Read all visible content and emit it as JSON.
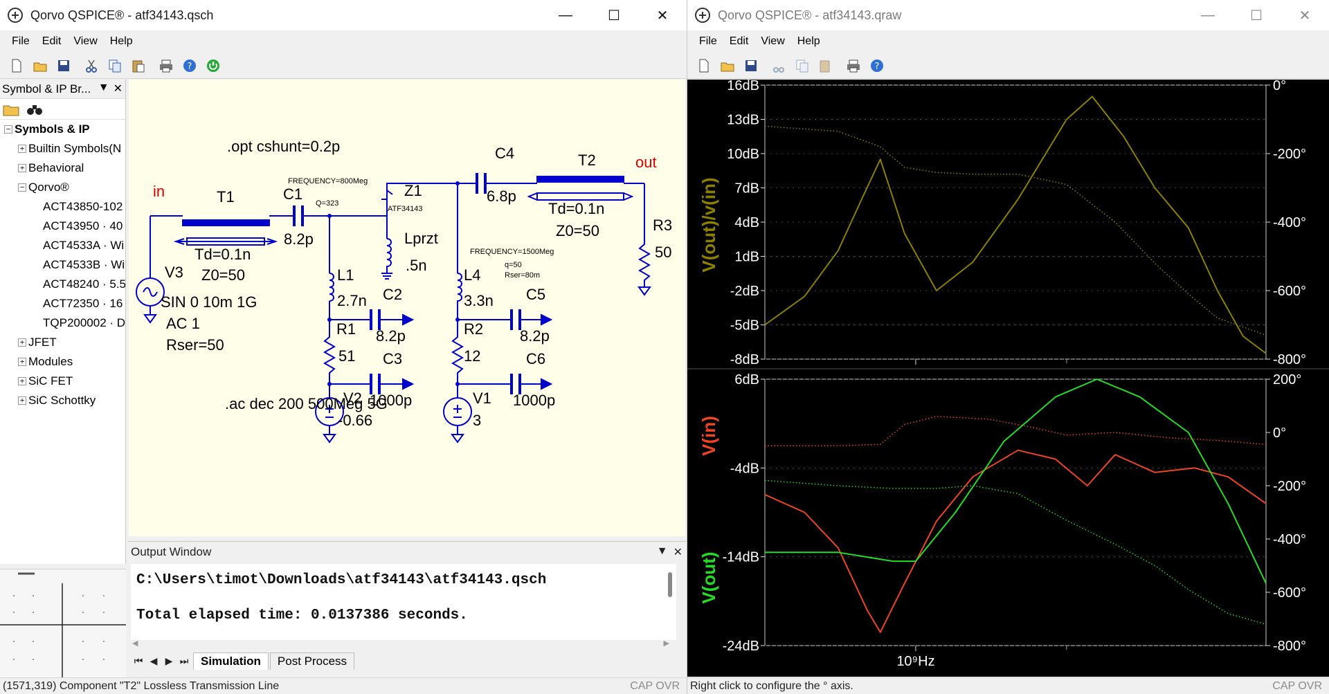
{
  "left_window": {
    "title": "Qorvo QSPICE® - atf34143.qsch",
    "menu": [
      "File",
      "Edit",
      "View",
      "Help"
    ],
    "symbol_browser": {
      "title": "Symbol & IP Br...",
      "tree": [
        {
          "label": "Symbols & IP",
          "level": 0,
          "exp": "⊟",
          "bold": true
        },
        {
          "label": "Builtin Symbols(N",
          "level": 1,
          "exp": "⊞"
        },
        {
          "label": "Behavioral",
          "level": 1,
          "exp": "⊞"
        },
        {
          "label": "Qorvo®",
          "level": 1,
          "exp": "⊟"
        },
        {
          "label": "ACT43850-102",
          "level": 2
        },
        {
          "label": "ACT43950 · 40",
          "level": 2
        },
        {
          "label": "ACT4533A · Wi",
          "level": 2
        },
        {
          "label": "ACT4533B · Wi",
          "level": 2
        },
        {
          "label": "ACT48240 · 5.5",
          "level": 2
        },
        {
          "label": "ACT72350 · 16",
          "level": 2
        },
        {
          "label": "TQP200002 · D",
          "level": 2
        },
        {
          "label": "JFET",
          "level": 1,
          "exp": "⊞"
        },
        {
          "label": "Modules",
          "level": 1,
          "exp": "⊞"
        },
        {
          "label": "SiC FET",
          "level": 1,
          "exp": "⊞"
        },
        {
          "label": "SiC Schottky",
          "level": 1,
          "exp": "⊞"
        }
      ]
    },
    "schematic": {
      "directive_opt": ".opt cshunt=0.2p",
      "directive_ac": ".ac dec 200 500Meg 5G",
      "in_label": "in",
      "out_label": "out",
      "T1": {
        "name": "T1",
        "td": "Td=0.1n",
        "z0": "Z0=50"
      },
      "T2": {
        "name": "T2",
        "td": "Td=0.1n",
        "z0": "Z0=50"
      },
      "C1": {
        "name": "C1",
        "value": "8.2p",
        "freq": "FREQUENCY=800Meg",
        "q": "Q=323"
      },
      "C4": {
        "name": "C4",
        "value": "6.8p"
      },
      "Z1": {
        "name": "Z1",
        "part": "ATF34143"
      },
      "Lprzt": {
        "name": "Lprzt",
        "value": ".5n"
      },
      "L1": {
        "name": "L1",
        "value": "2.7n"
      },
      "L4": {
        "name": "L4",
        "value": "3.3n",
        "freq": "FREQUENCY=1500Meg",
        "q": "q=50",
        "rser": "Rser=80m"
      },
      "R1": {
        "name": "R1",
        "value": "51"
      },
      "R2": {
        "name": "R2",
        "value": "12"
      },
      "R3": {
        "name": "R3",
        "value": "50"
      },
      "C2": {
        "name": "C2",
        "value": "8.2p"
      },
      "C3": {
        "name": "C3",
        "value": "1000p"
      },
      "C5": {
        "name": "C5",
        "value": "8.2p"
      },
      "C6": {
        "name": "C6",
        "value": "1000p"
      },
      "V1": {
        "name": "V1",
        "value": "3"
      },
      "V2": {
        "name": "V2",
        "value": "-0.66"
      },
      "V3": {
        "name": "V3",
        "line1": "SIN 0 10m 1G",
        "line2": "AC 1",
        "line3": "Rser=50"
      }
    },
    "output_window": {
      "title": "Output Window",
      "line1": "C:\\Users\\timot\\Downloads\\atf34143\\atf34143.qsch",
      "line2": "Total elapsed time: 0.0137386 seconds.",
      "tabs": [
        "Simulation",
        "Post Process"
      ]
    },
    "status": "(1571,319) Component \"T2\" Lossless Transmission Line",
    "capovr": "CAP OVR"
  },
  "right_window": {
    "title": "Qorvo QSPICE® - atf34143.qraw",
    "menu": [
      "File",
      "Edit",
      "View",
      "Help"
    ],
    "status": "Right click to configure the ° axis.",
    "capovr": "CAP OVR"
  },
  "colors": {
    "wire": "#0000cc",
    "net_label": "#dd0000",
    "trace_gain": "#8b8000",
    "trace_vin": "#ee4422",
    "trace_vout": "#22dd22"
  },
  "chart_data": [
    {
      "type": "line",
      "title": "",
      "ylabel": "V(out)/v(in)",
      "xlabel": "",
      "x_scale": "log",
      "xlim_hz": [
        500000000,
        5000000000
      ],
      "ylim": [
        -8,
        16
      ],
      "y_ticks": [
        "16dB",
        "13dB",
        "10dB",
        "7dB",
        "4dB",
        "1dB",
        "-2dB",
        "-5dB",
        "-8dB"
      ],
      "y2_ticks": [
        "0°",
        "-200°",
        "-400°",
        "-600°",
        "-800°"
      ],
      "y2lim": [
        -800,
        0
      ],
      "series": [
        {
          "name": "V(out)/v(in)",
          "unit": "dB",
          "style": "solid",
          "x_hz": [
            500000000,
            600000000,
            700000000,
            780000000,
            850000000,
            950000000,
            1100000000,
            1300000000,
            1600000000,
            2000000000,
            2250000000,
            2600000000,
            3000000000,
            3500000000,
            4000000000,
            4500000000,
            5000000000
          ],
          "values": [
            -5.0,
            -2.5,
            1.5,
            6.0,
            9.5,
            3.0,
            -2.0,
            0.5,
            6.0,
            13.0,
            15.0,
            11.5,
            7.0,
            3.5,
            -2.0,
            -6.0,
            -7.5
          ]
        },
        {
          "name": "V(out)/v(in) phase",
          "unit": "deg",
          "style": "dotted",
          "x_hz": [
            500000000,
            700000000,
            850000000,
            950000000,
            1100000000,
            1300000000,
            1600000000,
            2000000000,
            2500000000,
            3000000000,
            3500000000,
            4000000000,
            5000000000
          ],
          "values": [
            -120,
            -135,
            -180,
            -240,
            -255,
            -260,
            -260,
            -290,
            -400,
            -520,
            -610,
            -680,
            -730
          ]
        }
      ]
    },
    {
      "type": "line",
      "title": "",
      "ylabel": "V(in) / V(out)",
      "xlabel": "",
      "x_scale": "log",
      "xlim_hz": [
        500000000,
        5000000000
      ],
      "ylim": [
        -24,
        6
      ],
      "y_ticks": [
        "6dB",
        "-4dB",
        "-14dB",
        "-24dB"
      ],
      "y2_ticks": [
        "200°",
        "0°",
        "-200°",
        "-400°",
        "-600°",
        "-800°"
      ],
      "y2lim": [
        -800,
        200
      ],
      "x_tick_label": "10⁹Hz",
      "series": [
        {
          "name": "V(in)",
          "unit": "dB",
          "style": "solid",
          "x_hz": [
            500000000,
            600000000,
            700000000,
            800000000,
            850000000,
            950000000,
            1100000000,
            1300000000,
            1600000000,
            1900000000,
            2200000000,
            2500000000,
            3000000000,
            3600000000,
            4200000000,
            5000000000
          ],
          "values": [
            -7,
            -9,
            -13,
            -20,
            -22.5,
            -17,
            -10,
            -5,
            -2,
            -3,
            -6,
            -2.5,
            -4.5,
            -4,
            -5,
            -8
          ]
        },
        {
          "name": "V(out)",
          "unit": "dB",
          "style": "solid",
          "x_hz": [
            500000000,
            700000000,
            900000000,
            1000000000,
            1200000000,
            1500000000,
            1900000000,
            2300000000,
            2800000000,
            3500000000,
            4200000000,
            5000000000
          ],
          "values": [
            -13.5,
            -13.5,
            -14.5,
            -14.5,
            -9,
            -1,
            4,
            6,
            4,
            0,
            -8,
            -17
          ]
        },
        {
          "name": "V(in) phase",
          "unit": "deg",
          "style": "dotted",
          "x_hz": [
            500000000,
            700000000,
            850000000,
            950000000,
            1100000000,
            1400000000,
            1700000000,
            2000000000,
            2500000000,
            3200000000,
            4000000000,
            5000000000
          ],
          "values": [
            -50,
            -50,
            -45,
            30,
            60,
            50,
            20,
            -10,
            0,
            -20,
            -30,
            -45
          ]
        },
        {
          "name": "V(out) phase",
          "unit": "deg",
          "style": "dotted",
          "x_hz": [
            500000000,
            700000000,
            900000000,
            1100000000,
            1300000000,
            1600000000,
            2000000000,
            2500000000,
            3000000000,
            3500000000,
            4200000000,
            5000000000
          ],
          "values": [
            -180,
            -200,
            -210,
            -210,
            -200,
            -230,
            -330,
            -420,
            -500,
            -590,
            -680,
            -720
          ]
        }
      ]
    }
  ]
}
